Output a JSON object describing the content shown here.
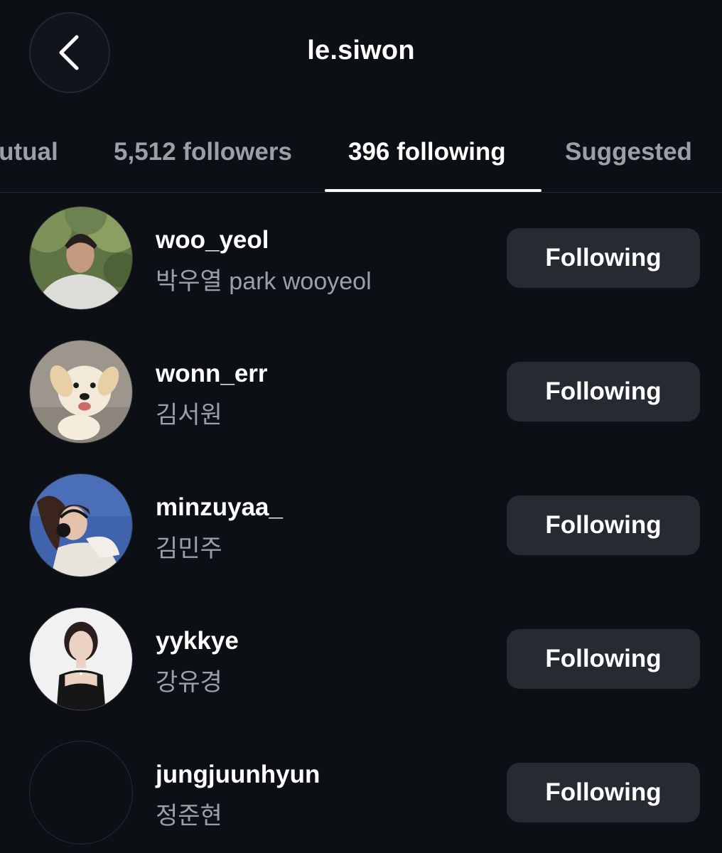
{
  "header": {
    "title": "le.siwon",
    "back_icon": "chevron-left-icon"
  },
  "tabs": [
    {
      "label": "mutual",
      "active": false
    },
    {
      "label": "5,512 followers",
      "active": false
    },
    {
      "label": "396 following",
      "active": true
    },
    {
      "label": "Suggested",
      "active": false
    }
  ],
  "accounts": [
    {
      "username": "woo_yeol",
      "full_name": "박우열 park wooyeol",
      "button_label": "Following"
    },
    {
      "username": "wonn_err",
      "full_name": "김서원",
      "button_label": "Following"
    },
    {
      "username": "minzuyaa_",
      "full_name": "김민주",
      "button_label": "Following"
    },
    {
      "username": "yykkye",
      "full_name": "강유경",
      "button_label": "Following"
    },
    {
      "username": "jungjuunhyun",
      "full_name": "정준현",
      "button_label": "Following"
    }
  ],
  "colors": {
    "background": "#0c0f14",
    "button_bg": "#262a31",
    "secondary_text": "#9aa0a8",
    "primary_text": "#ffffff"
  }
}
